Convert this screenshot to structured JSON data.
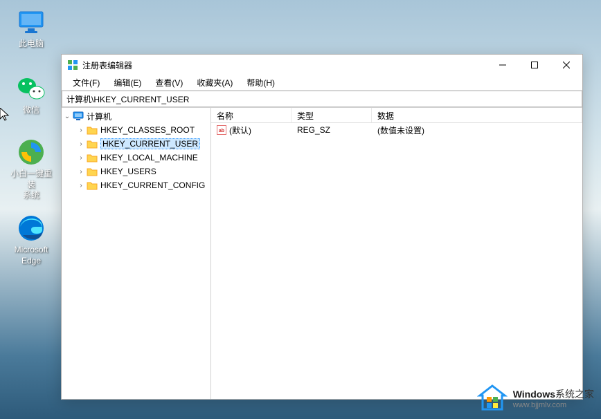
{
  "desktop": {
    "icons": [
      {
        "label": "此电脑"
      },
      {
        "label": "微信"
      },
      {
        "label": "小白一键重装\n系统"
      },
      {
        "label": "Microsoft\nEdge"
      }
    ]
  },
  "window": {
    "title": "注册表编辑器",
    "menus": [
      "文件(F)",
      "编辑(E)",
      "查看(V)",
      "收藏夹(A)",
      "帮助(H)"
    ],
    "address": "计算机\\HKEY_CURRENT_USER",
    "tree": {
      "root": "计算机",
      "hives": [
        "HKEY_CLASSES_ROOT",
        "HKEY_CURRENT_USER",
        "HKEY_LOCAL_MACHINE",
        "HKEY_USERS",
        "HKEY_CURRENT_CONFIG"
      ],
      "selected": "HKEY_CURRENT_USER"
    },
    "list": {
      "columns": [
        "名称",
        "类型",
        "数据"
      ],
      "rows": [
        {
          "name": "(默认)",
          "type": "REG_SZ",
          "data": "(数值未设置)"
        }
      ]
    }
  },
  "watermark": {
    "brand_prefix": "Windows",
    "brand_suffix": "系统之家",
    "url": "www.bjjmlv.com"
  }
}
